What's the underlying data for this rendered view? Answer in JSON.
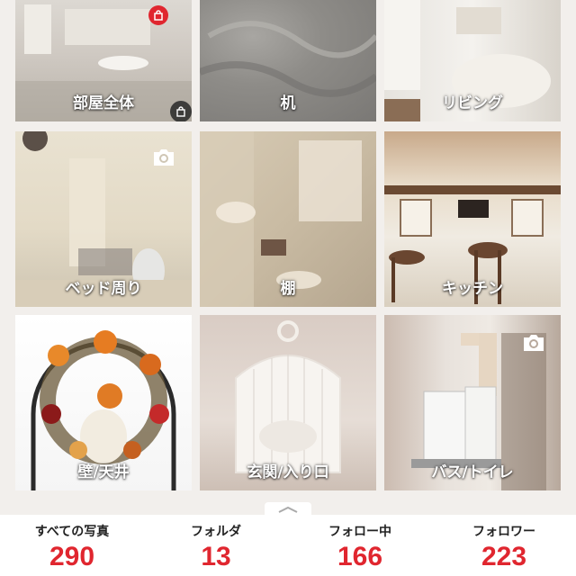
{
  "tiles": [
    {
      "label": "部屋全体",
      "badge": "shopping-bag-icon"
    },
    {
      "label": "机",
      "badge": ""
    },
    {
      "label": "リビング",
      "badge": ""
    },
    {
      "label": "ベッド周り",
      "badge": "camera-icon"
    },
    {
      "label": "棚",
      "badge": ""
    },
    {
      "label": "キッチン",
      "badge": ""
    },
    {
      "label": "壁/天井",
      "badge": ""
    },
    {
      "label": "玄関/入り口",
      "badge": ""
    },
    {
      "label": "バス/トイレ",
      "badge": "camera-icon"
    }
  ],
  "handle": {
    "icon": "chevron-up-icon"
  },
  "stats": [
    {
      "label": "すべての写真",
      "value": "290"
    },
    {
      "label": "フォルダ",
      "value": "13"
    },
    {
      "label": "フォロー中",
      "value": "166"
    },
    {
      "label": "フォロワー",
      "value": "223"
    }
  ],
  "colors": {
    "accent": "#e0262f",
    "background": "#f2efec"
  }
}
